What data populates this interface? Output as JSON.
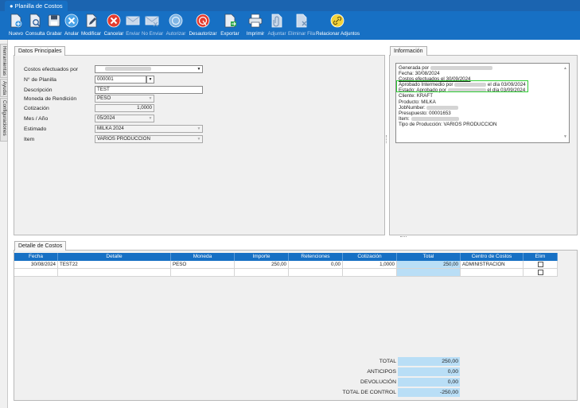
{
  "window": {
    "tab_title": "Planilla de Costos"
  },
  "colors": {
    "toolbar": "#1770c4",
    "accent_highlight": "#2fcc35",
    "grid_header": "#1770c4",
    "total_cell": "#b9def6"
  },
  "toolbar": {
    "buttons": [
      {
        "label": "Nuevo",
        "icon": "new-document-icon",
        "enabled": true
      },
      {
        "label": "Consulta",
        "icon": "search-document-icon",
        "enabled": true
      },
      {
        "label": "Grabar",
        "icon": "save-disk-icon",
        "enabled": true
      },
      {
        "label": "Anular",
        "icon": "cancel-x-icon",
        "enabled": true
      },
      {
        "label": "Modificar",
        "icon": "edit-document-icon",
        "enabled": true
      },
      {
        "label": "Cancelar",
        "icon": "red-x-circle-icon",
        "enabled": true
      },
      {
        "label": "Enviar",
        "icon": "send-envelope-icon",
        "enabled": false
      },
      {
        "label": "No Enviar",
        "icon": "no-send-envelope-icon",
        "enabled": false
      },
      {
        "label": "Autorizar",
        "icon": "authorize-icon",
        "enabled": false
      },
      {
        "label": "Desautorizar",
        "icon": "unauthorize-icon",
        "enabled": true
      },
      {
        "label": "Exportar",
        "icon": "export-icon",
        "enabled": true
      },
      {
        "label": "Imprimir",
        "icon": "printer-icon",
        "enabled": true
      },
      {
        "label": "Adjuntar",
        "icon": "attach-icon",
        "enabled": false
      },
      {
        "label": "Eliminar Fila",
        "icon": "delete-row-icon",
        "enabled": false
      },
      {
        "label": "Relacionar Adjuntos",
        "icon": "link-attachments-icon",
        "enabled": true
      }
    ]
  },
  "sidetabs": [
    "Herramientas",
    "Ayuda",
    "Configuraciones"
  ],
  "datos": {
    "tab": "Datos Principales",
    "costos_label": "Costos efectuados por",
    "planilla_label": "N° de Planilla",
    "planilla_value": "000001",
    "descripcion_label": "Descripción",
    "descripcion_value": "TEST",
    "moneda_label": "Moneda de Rendición",
    "moneda_value": "PESO",
    "cotizacion_label": "Cotización",
    "cotizacion_value": "1,0000",
    "mes_label": "Mes / Año",
    "mes_value": "05/2024",
    "estimado_label": "Estimado",
    "estimado_value": "MILKA 2024",
    "item_label": "Item",
    "item_value": "VARIOS PRODUCCION"
  },
  "informacion": {
    "tab": "Información",
    "generada": "Generada por",
    "fecha": "Fecha: 30/08/2024",
    "costos": "Costos efectuados el 30/09/2024",
    "aprobado_int": "Aprobado Intermedio por",
    "aprobado_int_date": "el día 03/09/2024",
    "estado": "Estado: Aprobado por",
    "estado_date": "el día 03/09/2024",
    "cliente": "Cliente: KRAFT",
    "producto": "Producto: MILKA",
    "jobnumber": "JobNumber:",
    "presupuesto": "Presupuesto: 00001653",
    "item": "Item:",
    "tipo": "Tipo de Producción: VARIOS PRODUCCION"
  },
  "detalle": {
    "tab": "Detalle de Costos",
    "columns": [
      "Fecha",
      "Detalle",
      "Moneda",
      "Importe",
      "Retenciones",
      "Cotización",
      "Total",
      "Centro de Costos",
      "Elim"
    ],
    "rows": [
      {
        "fecha": "30/08/2024",
        "detalle": "TEST22",
        "moneda": "PESO",
        "importe": "250,00",
        "retenciones": "0,00",
        "cotizacion": "1,0000",
        "total": "250,00",
        "centro": "ADMINISTRACION"
      }
    ]
  },
  "totals": {
    "total_label": "TOTAL",
    "total_value": "250,00",
    "anticipos_label": "ANTICIPOS",
    "anticipos_value": "0,00",
    "devolucion_label": "DEVOLUCIÓN",
    "devolucion_value": "0,00",
    "control_label": "TOTAL DE CONTROL",
    "control_value": "-250,00"
  }
}
